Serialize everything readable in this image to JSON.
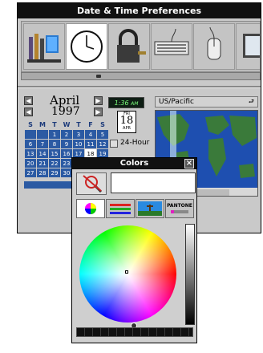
{
  "main_window": {
    "title": "Date & Time Preferences",
    "icons": [
      "rack-icon",
      "clock-icon",
      "padlock-icon",
      "keyboard-icon",
      "mouse-icon",
      "monitor-icon"
    ],
    "calendar": {
      "month": "April",
      "year": "1997",
      "weekdays": [
        "S",
        "M",
        "T",
        "W",
        "T",
        "F",
        "S"
      ],
      "weeks": [
        [
          "",
          "",
          "1",
          "2",
          "3",
          "4",
          "5"
        ],
        [
          "6",
          "7",
          "8",
          "9",
          "10",
          "11",
          "12"
        ],
        [
          "13",
          "14",
          "15",
          "16",
          "17",
          "18",
          "19"
        ],
        [
          "20",
          "21",
          "22",
          "23",
          "24",
          "25",
          "26"
        ],
        [
          "27",
          "28",
          "29",
          "30",
          "",
          "",
          ""
        ]
      ],
      "selected_day": "18"
    },
    "clock": {
      "time": "1:36",
      "meridiem": "AM"
    },
    "date_icon": {
      "weekday": "FRI",
      "day": "18",
      "month": "APR"
    },
    "checkbox_24hour": "24-Hour",
    "timezone": "US/Pacific"
  },
  "colors_window": {
    "title": "Colors",
    "tabs": [
      "color-wheel-icon",
      "sliders-icon",
      "image-palette-icon",
      "pantone-icon"
    ],
    "pantone_label": "PANTONE",
    "accent": "#2b5aa3"
  }
}
